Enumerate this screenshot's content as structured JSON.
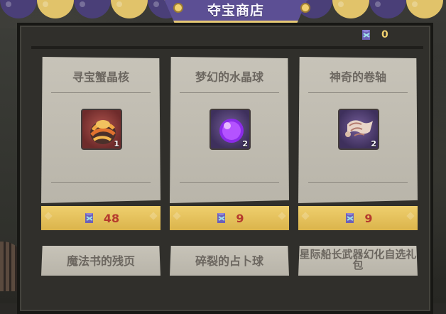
{
  "title": "夺宝商店",
  "currency": {
    "value": "0",
    "icon": "rune-scroll-icon"
  },
  "cards": [
    {
      "title": "寻宝蟹晶核",
      "count": "1",
      "price": "48",
      "icon": "crab-crystal-core-icon",
      "frame_color": "#a74a43"
    },
    {
      "title": "梦幻的水晶球",
      "count": "2",
      "price": "9",
      "icon": "purple-crystal-ball-icon",
      "frame_color": "#6b5a94"
    },
    {
      "title": "神奇的卷轴",
      "count": "2",
      "price": "9",
      "icon": "magic-scroll-icon",
      "frame_color": "#6b5a94"
    }
  ],
  "mini_cards": [
    "魔法书的残页",
    "碎裂的占卜球",
    "星际船长武器幻化自选礼包"
  ],
  "colors": {
    "panel": "#302f2b",
    "card": "#c2beb3",
    "price": "#e8c65c",
    "title_bg": "#5c4f94"
  }
}
